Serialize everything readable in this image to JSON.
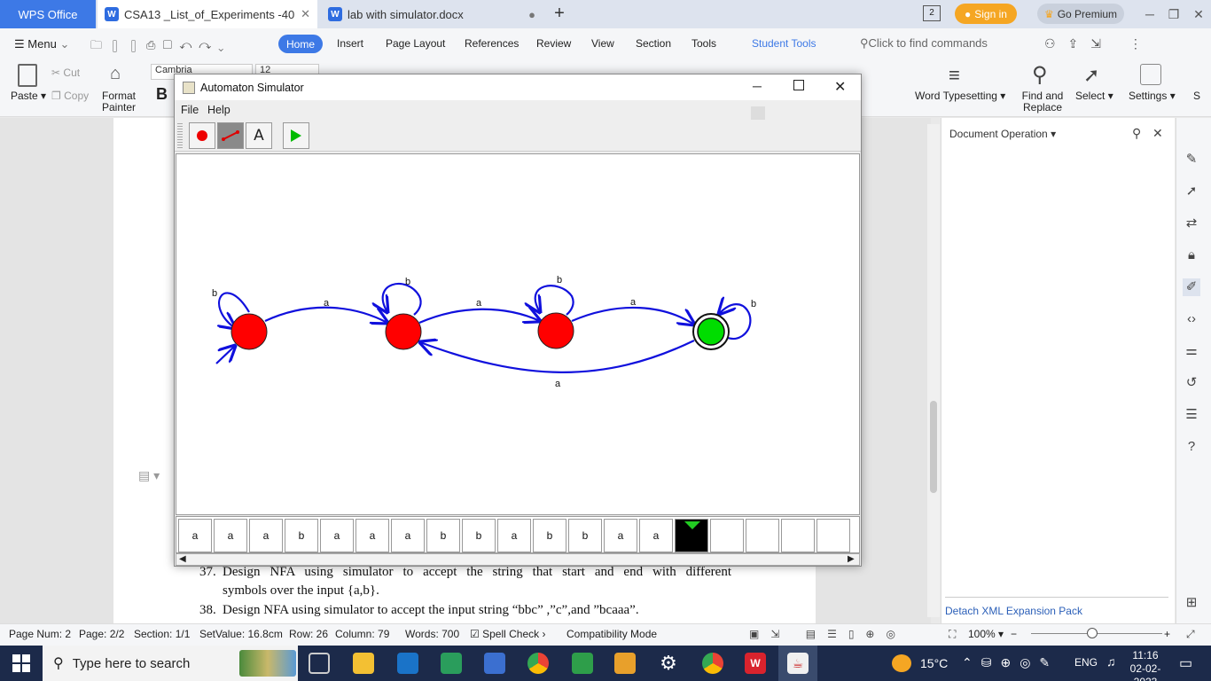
{
  "wps": {
    "app_tab": "WPS Office",
    "tabs": [
      {
        "label": "CSA13 _List_of_Experiments -40"
      },
      {
        "label": "lab with simulator.docx"
      }
    ],
    "sign_in": "Sign in",
    "go_premium": "Go Premium"
  },
  "menubar": {
    "menu": "Menu",
    "items": [
      "Home",
      "Insert",
      "Page Layout",
      "References",
      "Review",
      "View",
      "Section",
      "Tools",
      "Student Tools"
    ],
    "find_placeholder": "Click to find commands"
  },
  "ribbon": {
    "paste": "Paste",
    "cut": "Cut",
    "copy": "Copy",
    "format_painter_1": "Format",
    "format_painter_2": "Painter",
    "font_name": "Cambria",
    "font_size": "12",
    "bold": "B",
    "word_typesetting": "Word Typesetting",
    "find_replace_1": "Find and",
    "find_replace_2": "Replace",
    "select": "Select",
    "settings": "Settings",
    "more": "S"
  },
  "document": {
    "line_37_num": "37.",
    "line_37a": "Design NFA using simulator to accept the string that start and end with different",
    "line_37b": "symbols over the input {a,b}.",
    "line_38_num": "38.",
    "line_38": "Design NFA using simulator to accept the input string “bbc” ,”c”,and ”bcaaa”."
  },
  "right_panel": {
    "title": "Document Operation",
    "footer": "Detach XML Expansion Pack"
  },
  "statusbar": {
    "page_num": "Page Num: 2",
    "page": "Page: 2/2",
    "section": "Section: 1/1",
    "set_value": "SetValue: 16.8cm",
    "row": "Row: 26",
    "column": "Column: 79",
    "words": "Words: 700",
    "spell_check": "Spell Check",
    "compat": "Compatibility Mode",
    "zoom": "100%"
  },
  "taskbar": {
    "search_placeholder": "Type here to search",
    "temperature": "15°C",
    "language": "ENG",
    "time": "11:16",
    "date": "02-02-2023"
  },
  "simulator": {
    "title": "Automaton Simulator",
    "menu_file": "File",
    "menu_help": "Help",
    "text_tool": "A",
    "states": [
      {
        "id": "q0",
        "initial": true,
        "accepting": false,
        "color": "#ff0000"
      },
      {
        "id": "q1",
        "initial": false,
        "accepting": false,
        "color": "#ff0000"
      },
      {
        "id": "q2",
        "initial": false,
        "accepting": false,
        "color": "#ff0000"
      },
      {
        "id": "q3",
        "initial": false,
        "accepting": true,
        "color": "#00dd00"
      }
    ],
    "transitions": [
      {
        "from": "q0",
        "to": "q0",
        "symbol": "b"
      },
      {
        "from": "q0",
        "to": "q1",
        "symbol": "a"
      },
      {
        "from": "q1",
        "to": "q1",
        "symbol": "b"
      },
      {
        "from": "q1",
        "to": "q2",
        "symbol": "a"
      },
      {
        "from": "q2",
        "to": "q2",
        "symbol": "b"
      },
      {
        "from": "q2",
        "to": "q3",
        "symbol": "a"
      },
      {
        "from": "q3",
        "to": "q3",
        "symbol": "b"
      },
      {
        "from": "q3",
        "to": "q1",
        "symbol": "a"
      }
    ],
    "tape": [
      "a",
      "a",
      "a",
      "b",
      "a",
      "a",
      "a",
      "b",
      "b",
      "a",
      "b",
      "b",
      "a",
      "a",
      "",
      "",
      "",
      "",
      ""
    ],
    "head_index": 14,
    "edge_color": "#1010dd"
  }
}
